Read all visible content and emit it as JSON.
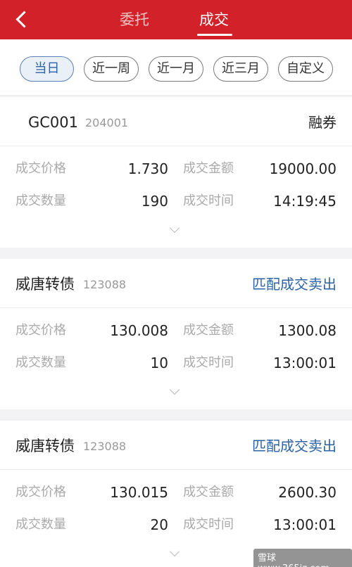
{
  "header": {
    "tabs": [
      {
        "label": "委托",
        "active": false
      },
      {
        "label": "成交",
        "active": true
      }
    ]
  },
  "filters": [
    "当日",
    "近一周",
    "近一月",
    "近三月",
    "自定义"
  ],
  "field_labels": {
    "price": "成交价格",
    "amount": "成交金额",
    "quantity": "成交数量",
    "time": "成交时间"
  },
  "trades": [
    {
      "name": "GC001",
      "code": "204001",
      "action": "融券",
      "price": "1.730",
      "amount": "19000.00",
      "quantity": "190",
      "time": "14:19:45"
    },
    {
      "name": "威唐转债",
      "code": "123088",
      "action": "匹配成交卖出",
      "price": "130.008",
      "amount": "1300.08",
      "quantity": "10",
      "time": "13:00:01"
    },
    {
      "name": "威唐转债",
      "code": "123088",
      "action": "匹配成交卖出",
      "price": "130.015",
      "amount": "2600.30",
      "quantity": "20",
      "time": "13:00:01"
    }
  ],
  "colors": {
    "brand": "#d22128",
    "link": "#2d62a8"
  },
  "watermark": "雪球 www.365jz.com"
}
